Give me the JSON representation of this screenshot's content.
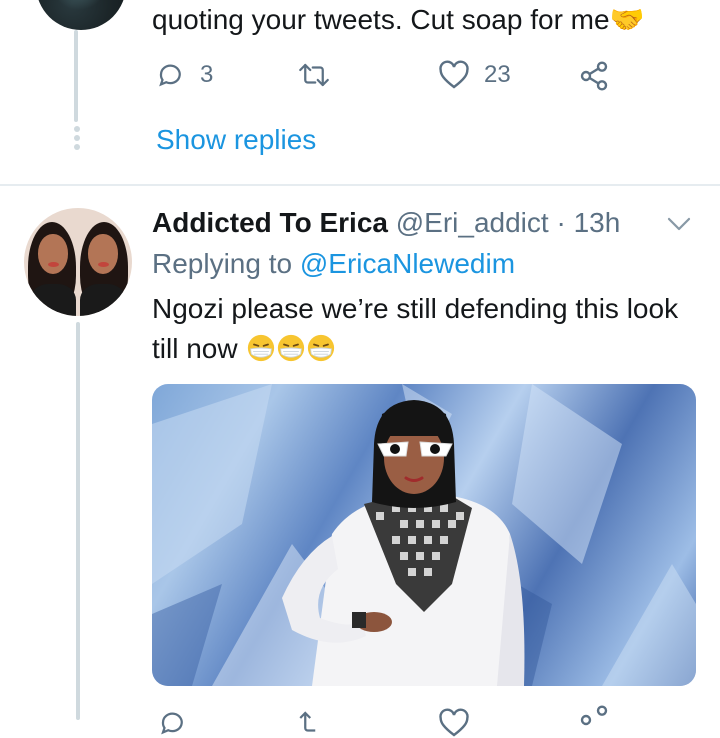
{
  "previous_tweet": {
    "text": "quoting your tweets. Cut soap for me🤝",
    "reply_count": "3",
    "like_count": "23",
    "show_replies": "Show replies"
  },
  "tweet": {
    "display_name": "Addicted To Erica",
    "handle": "@Eri_addict",
    "separator": " · ",
    "time": "13h",
    "replying_prefix": "Replying to ",
    "replying_to": "@EricaNlewedim",
    "text": "Ngozi please we’re still defending this look till now",
    "emojis": [
      "face-with-medical-mask",
      "face-with-medical-mask",
      "face-with-medical-mask"
    ],
    "media_alt_icon": "photo"
  },
  "colors": {
    "accent": "#1b95e0",
    "secondary_text": "#5b7083",
    "thread_line": "#cfd9de",
    "divider": "#e6ecf0"
  },
  "icons": [
    "reply-icon",
    "retweet-icon",
    "like-icon",
    "share-icon",
    "chevron-down-icon"
  ]
}
